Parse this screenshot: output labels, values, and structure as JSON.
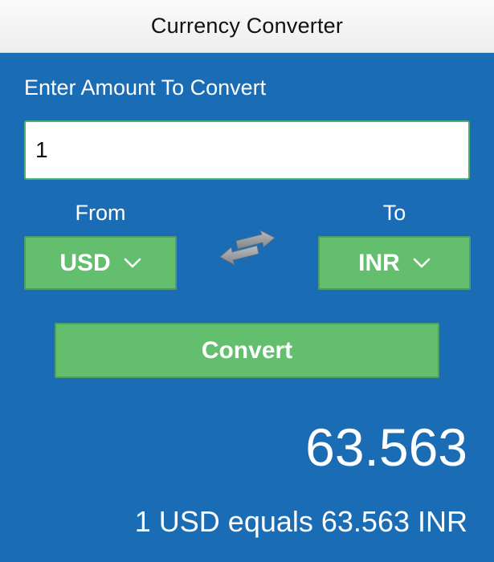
{
  "header": {
    "title": "Currency Converter"
  },
  "amount": {
    "label": "Enter Amount To Convert",
    "value": "1"
  },
  "from": {
    "label": "From",
    "currency": "USD",
    "icon": "chevron-down-icon"
  },
  "to": {
    "label": "To",
    "currency": "INR",
    "icon": "chevron-down-icon"
  },
  "swap": {
    "icon": "swap-arrows-icon"
  },
  "convert": {
    "label": "Convert"
  },
  "result": {
    "value": "63.563",
    "summary": "1 USD equals 63.563 INR"
  },
  "colors": {
    "background": "#1a6db5",
    "button": "#63bf6e",
    "button_border": "#4d9e6c",
    "input_border": "#48b27e",
    "navbar": "#f5f5f6"
  }
}
